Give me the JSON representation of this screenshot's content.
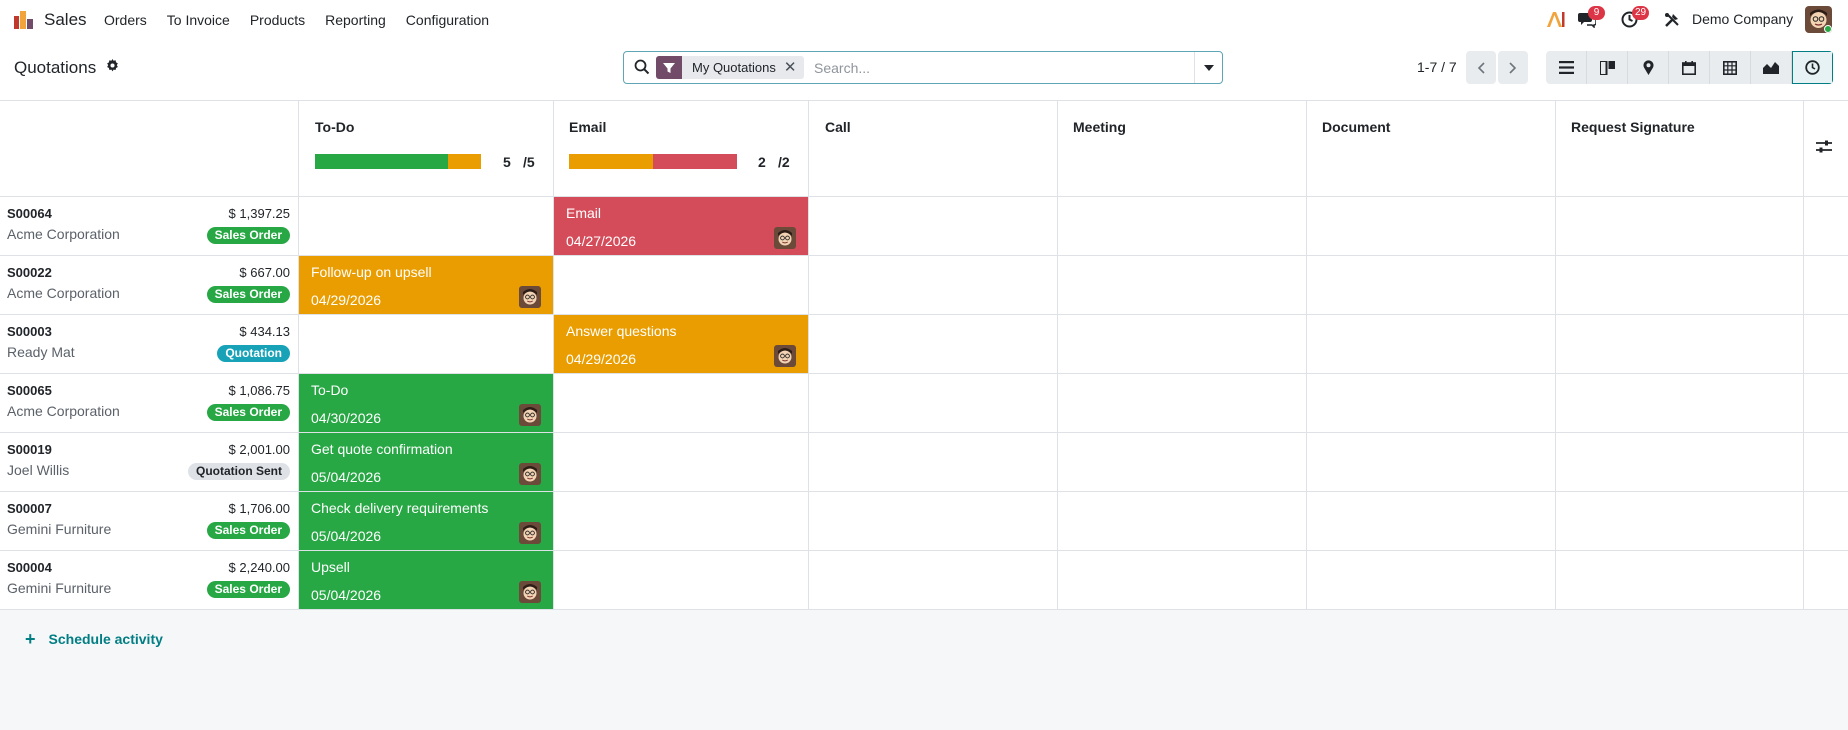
{
  "app": {
    "name": "Sales"
  },
  "menu": [
    "Orders",
    "To Invoice",
    "Products",
    "Reporting",
    "Configuration"
  ],
  "systray": {
    "messages_count": "9",
    "activities_count": "29",
    "company": "Demo Company"
  },
  "page": {
    "title": "Quotations"
  },
  "search": {
    "facet": "My Quotations",
    "placeholder": "Search..."
  },
  "pager": {
    "value": "1-7 / 7"
  },
  "views": [
    "list-view-icon",
    "kanban-view-icon",
    "map-view-icon",
    "calendar-view-icon",
    "pivot-view-icon",
    "graph-view-icon",
    "activity-view-icon"
  ],
  "columns": [
    {
      "title": "To-Do",
      "count": "5",
      "total": "/5",
      "progress": [
        {
          "color": "#28a745",
          "fraction": 0.8
        },
        {
          "color": "#e99d00",
          "fraction": 0.2
        }
      ]
    },
    {
      "title": "Email",
      "count": "2",
      "total": "/2",
      "progress": [
        {
          "color": "#e99d00",
          "fraction": 0.5
        },
        {
          "color": "#d44c59",
          "fraction": 0.5
        }
      ]
    },
    {
      "title": "Call"
    },
    {
      "title": "Meeting"
    },
    {
      "title": "Document"
    },
    {
      "title": "Request Signature"
    }
  ],
  "rows": [
    {
      "name": "S00064",
      "partner": "Acme Corporation",
      "amount": "$ 1,397.25",
      "status": "Sales Order",
      "status_type": "green",
      "activity": {
        "col": 1,
        "title": "Email",
        "date": "04/27/2026",
        "color": "red"
      }
    },
    {
      "name": "S00022",
      "partner": "Acme Corporation",
      "amount": "$ 667.00",
      "status": "Sales Order",
      "status_type": "green",
      "activity": {
        "col": 0,
        "title": "Follow-up on upsell",
        "date": "04/29/2026",
        "color": "orange"
      }
    },
    {
      "name": "S00003",
      "partner": "Ready Mat",
      "amount": "$ 434.13",
      "status": "Quotation",
      "status_type": "blue",
      "activity": {
        "col": 1,
        "title": "Answer questions",
        "date": "04/29/2026",
        "color": "orange"
      }
    },
    {
      "name": "S00065",
      "partner": "Acme Corporation",
      "amount": "$ 1,086.75",
      "status": "Sales Order",
      "status_type": "green",
      "activity": {
        "col": 0,
        "title": "To-Do",
        "date": "04/30/2026",
        "color": "green"
      }
    },
    {
      "name": "S00019",
      "partner": "Joel Willis",
      "amount": "$ 2,001.00",
      "status": "Quotation Sent",
      "status_type": "grey",
      "activity": {
        "col": 0,
        "title": "Get quote confirmation",
        "date": "05/04/2026",
        "color": "green"
      }
    },
    {
      "name": "S00007",
      "partner": "Gemini Furniture",
      "amount": "$ 1,706.00",
      "status": "Sales Order",
      "status_type": "green",
      "activity": {
        "col": 0,
        "title": "Check delivery requirements",
        "date": "05/04/2026",
        "color": "green"
      }
    },
    {
      "name": "S00004",
      "partner": "Gemini Furniture",
      "amount": "$ 2,240.00",
      "status": "Sales Order",
      "status_type": "green",
      "activity": {
        "col": 0,
        "title": "Upsell",
        "date": "05/04/2026",
        "color": "green"
      }
    }
  ],
  "footer": {
    "schedule_label": "Schedule activity"
  }
}
